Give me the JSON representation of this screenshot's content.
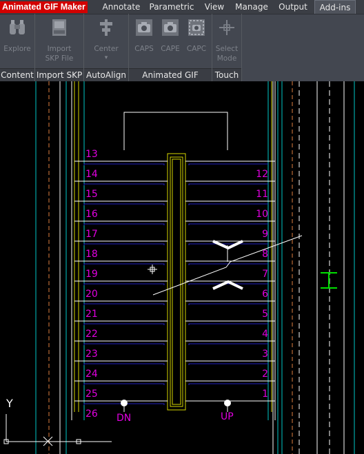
{
  "ribbon": {
    "plugin_title": "Animated GIF Maker",
    "tabs": [
      {
        "label": "Annotate"
      },
      {
        "label": "Parametric"
      },
      {
        "label": "View"
      },
      {
        "label": "Manage"
      },
      {
        "label": "Output"
      },
      {
        "label": "Add-ins"
      }
    ],
    "panels": {
      "content": {
        "label": "Content",
        "buttons": [
          {
            "label1": "Explore",
            "icon": "binoculars-icon"
          }
        ]
      },
      "import_skp": {
        "label": "Import SKP",
        "buttons": [
          {
            "label1": "Import",
            "label2": "SKP File",
            "icon": "sketchup-file-icon"
          }
        ]
      },
      "autoalign": {
        "label": "AutoAlign",
        "buttons": [
          {
            "label1": "Center",
            "icon": "center-align-icon"
          }
        ]
      },
      "gif_maker": {
        "label": "Animated GIF Maker",
        "buttons": [
          {
            "label1": "CAPS",
            "icon": "camera-icon"
          },
          {
            "label1": "CAPE",
            "icon": "camera-icon"
          },
          {
            "label1": "CAPC",
            "icon": "film-camera-icon"
          }
        ]
      },
      "touch": {
        "label": "Touch",
        "buttons": [
          {
            "label1": "Select",
            "label2": "Mode",
            "icon": "crosshair-icon"
          }
        ]
      }
    }
  },
  "drawing": {
    "left_steps": [
      "13",
      "14",
      "15",
      "16",
      "17",
      "18",
      "19",
      "20",
      "21",
      "22",
      "23",
      "24",
      "25",
      "26"
    ],
    "right_steps": [
      "12",
      "11",
      "10",
      "9",
      "8",
      "7",
      "6",
      "5",
      "4",
      "3",
      "2",
      "1"
    ],
    "dn_label": "DN",
    "up_label": "UP",
    "ucs": {
      "x_label": "X",
      "y_label": "Y"
    },
    "colors": {
      "steps": "#e000e0",
      "treads": "#ffffff",
      "nosing": "#2020c0",
      "handrail": "#d8d800",
      "walls": "#00c8c8",
      "column": "#00e000"
    }
  }
}
